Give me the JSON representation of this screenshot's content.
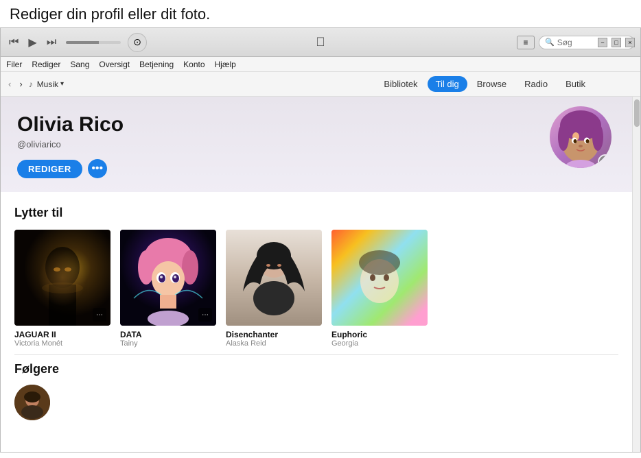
{
  "tooltip": {
    "text": "Rediger din profil eller dit foto."
  },
  "titlebar": {
    "rewind_label": "⏮",
    "play_label": "▶",
    "forward_label": "⏭",
    "airplay_label": "⊙",
    "list_btn_label": "≡",
    "search_placeholder": "Søg",
    "window_controls": [
      "−",
      "□",
      "×"
    ]
  },
  "menubar": {
    "items": [
      "Filer",
      "Rediger",
      "Sang",
      "Oversigt",
      "Betjening",
      "Konto",
      "Hjælp"
    ]
  },
  "navbar": {
    "music_label": "Musik",
    "tabs": [
      {
        "label": "Bibliotek",
        "active": false
      },
      {
        "label": "Til dig",
        "active": true
      },
      {
        "label": "Browse",
        "active": false
      },
      {
        "label": "Radio",
        "active": false
      },
      {
        "label": "Butik",
        "active": false
      }
    ]
  },
  "profile": {
    "name": "Olivia Rico",
    "handle": "@oliviarico",
    "edit_btn": "REDIGER",
    "more_btn": "•••"
  },
  "listening_section": {
    "title": "Lytter til",
    "albums": [
      {
        "title": "JAGUAR II",
        "artist": "Victoria Monét",
        "cover_type": "jaguar"
      },
      {
        "title": "DATA",
        "artist": "Tainy",
        "cover_type": "data"
      },
      {
        "title": "Disenchanter",
        "artist": "Alaska Reid",
        "cover_type": "disenchanter"
      },
      {
        "title": "Euphoric",
        "artist": "Georgia",
        "cover_type": "euphoric"
      }
    ]
  },
  "followers_section": {
    "title": "Følgere"
  }
}
